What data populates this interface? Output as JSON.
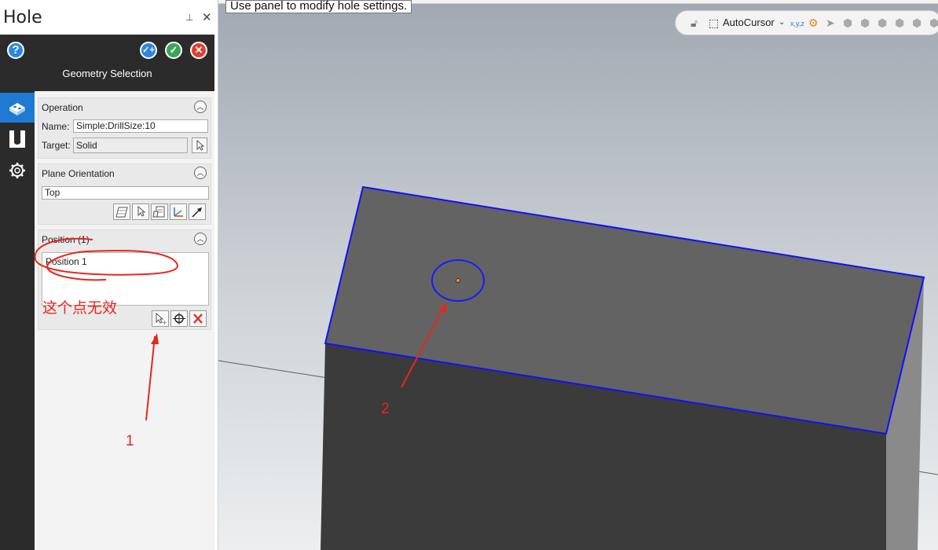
{
  "panel": {
    "title": "Hole",
    "pin_icon": "pin-icon",
    "close_icon": "close-icon",
    "header": {
      "subtitle": "Geometry Selection",
      "help_label": "?",
      "buttons": [
        "help-button",
        "apply-add-button",
        "ok-button",
        "cancel-button"
      ]
    },
    "tabs": [
      "hole-tab",
      "profile-tab",
      "settings-tab"
    ],
    "operation": {
      "title": "Operation",
      "name_label": "Name:",
      "name_value": "Simple:DrillSize:10",
      "target_label": "Target:",
      "target_value": "Solid"
    },
    "plane": {
      "title": "Plane Orientation",
      "value": "Top"
    },
    "position": {
      "title": "Position (1)",
      "items": [
        "Position 1"
      ]
    }
  },
  "tooltip": "Use panel to modify hole settings.",
  "toolbar": {
    "autocursor_label": "AutoCursor",
    "xyz_label": "x,y,z"
  },
  "annotations": {
    "note_text": "这个点无效",
    "label_1": "1",
    "label_2": "2",
    "color": "#e5281e"
  },
  "colors": {
    "header_bg": "#2b2b2b",
    "active_tab": "#1e7bd1",
    "edge_highlight": "#0000ff",
    "top_face": "#626262",
    "front_face": "#3a3a3a",
    "side_face": "#8a8a8a"
  }
}
